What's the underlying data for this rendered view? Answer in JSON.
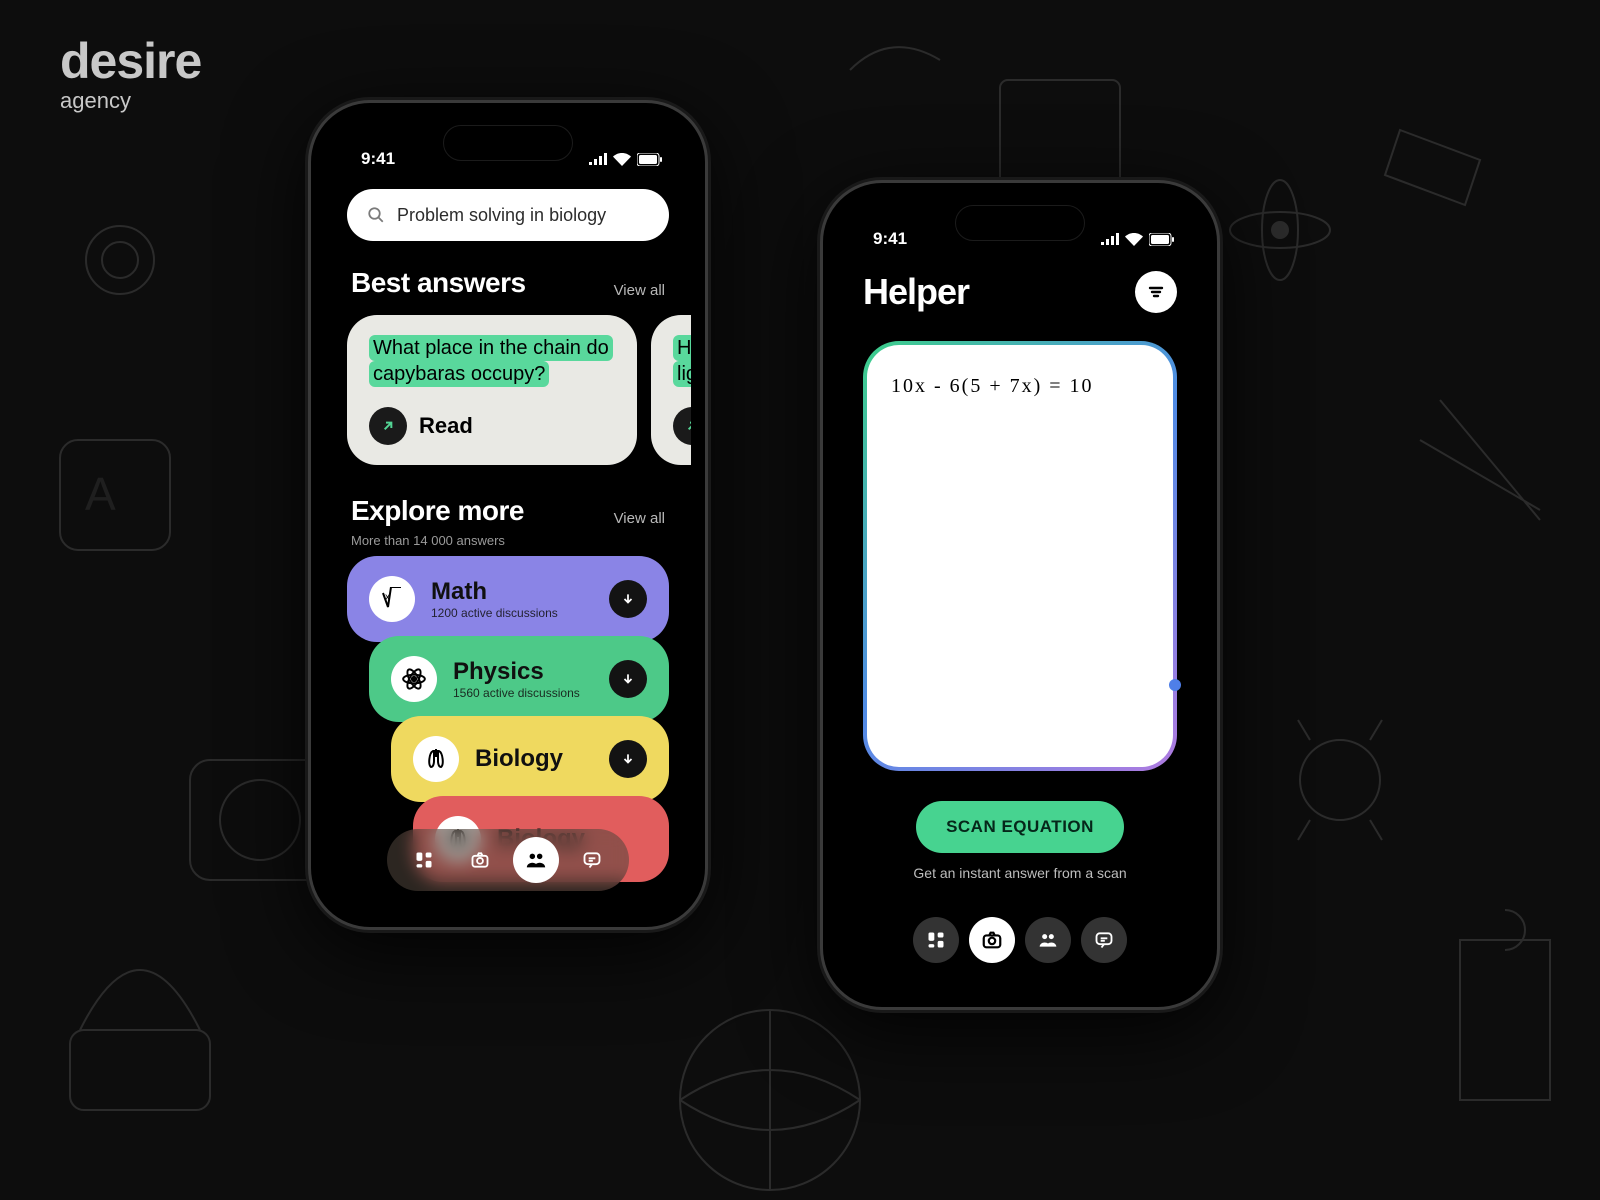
{
  "brand": {
    "name": "desire",
    "tag": "agency"
  },
  "status": {
    "time": "9:41"
  },
  "left": {
    "search_placeholder": "Problem solving in biology",
    "best": {
      "title": "Best answers",
      "view_all": "View all",
      "cards": [
        {
          "question": "What place in the chain do capybaras occupy?",
          "cta": "Read"
        },
        {
          "question": "Ho\nlig",
          "cta": ""
        }
      ]
    },
    "explore": {
      "title": "Explore more",
      "subtitle": "More than 14 000 answers",
      "view_all": "View all",
      "subjects": [
        {
          "name": "Math",
          "meta": "1200 active discussions"
        },
        {
          "name": "Physics",
          "meta": "1560 active discussions"
        },
        {
          "name": "Biology",
          "meta": ""
        },
        {
          "name": "Biology",
          "meta": ""
        }
      ]
    }
  },
  "right": {
    "title": "Helper",
    "equation": "10x - 6(5 + 7x)  =  10",
    "scan_btn": "SCAN EQUATION",
    "caption": "Get an instant answer from a scan"
  }
}
